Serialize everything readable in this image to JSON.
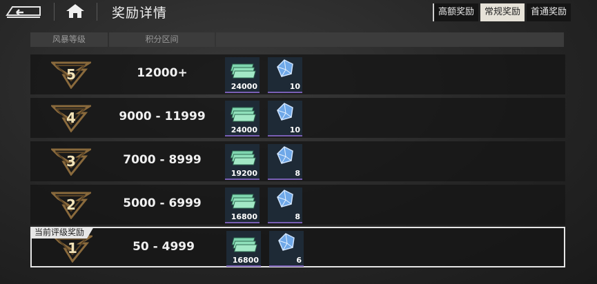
{
  "header": {
    "title": "奖励详情",
    "tabs": [
      {
        "label": "高额奖励",
        "active": false
      },
      {
        "label": "常规奖励",
        "active": true
      },
      {
        "label": "首通奖励",
        "active": false
      }
    ]
  },
  "table": {
    "columns": [
      "风暴等级",
      "积分区间"
    ],
    "current_tag": "当前评级奖励",
    "rows": [
      {
        "rank": "5",
        "range": "12000+",
        "cash": "24000",
        "gems": "10",
        "current": false
      },
      {
        "rank": "4",
        "range": "9000 - 11999",
        "cash": "24000",
        "gems": "10",
        "current": false
      },
      {
        "rank": "3",
        "range": "7000 - 8999",
        "cash": "19200",
        "gems": "8",
        "current": false
      },
      {
        "rank": "2",
        "range": "5000 - 6999",
        "cash": "16800",
        "gems": "8",
        "current": false
      },
      {
        "rank": "1",
        "range": "50 - 4999",
        "cash": "16800",
        "gems": "6",
        "current": true
      }
    ]
  },
  "colors": {
    "accent_gold": "#c9a86a",
    "item_border_purple": "#7a5fb5",
    "active_tab": "#e6e2d8"
  },
  "icons": [
    "back-icon",
    "home-icon",
    "storm-rank-badge-icon",
    "cash-stack-icon",
    "gem-icon"
  ]
}
